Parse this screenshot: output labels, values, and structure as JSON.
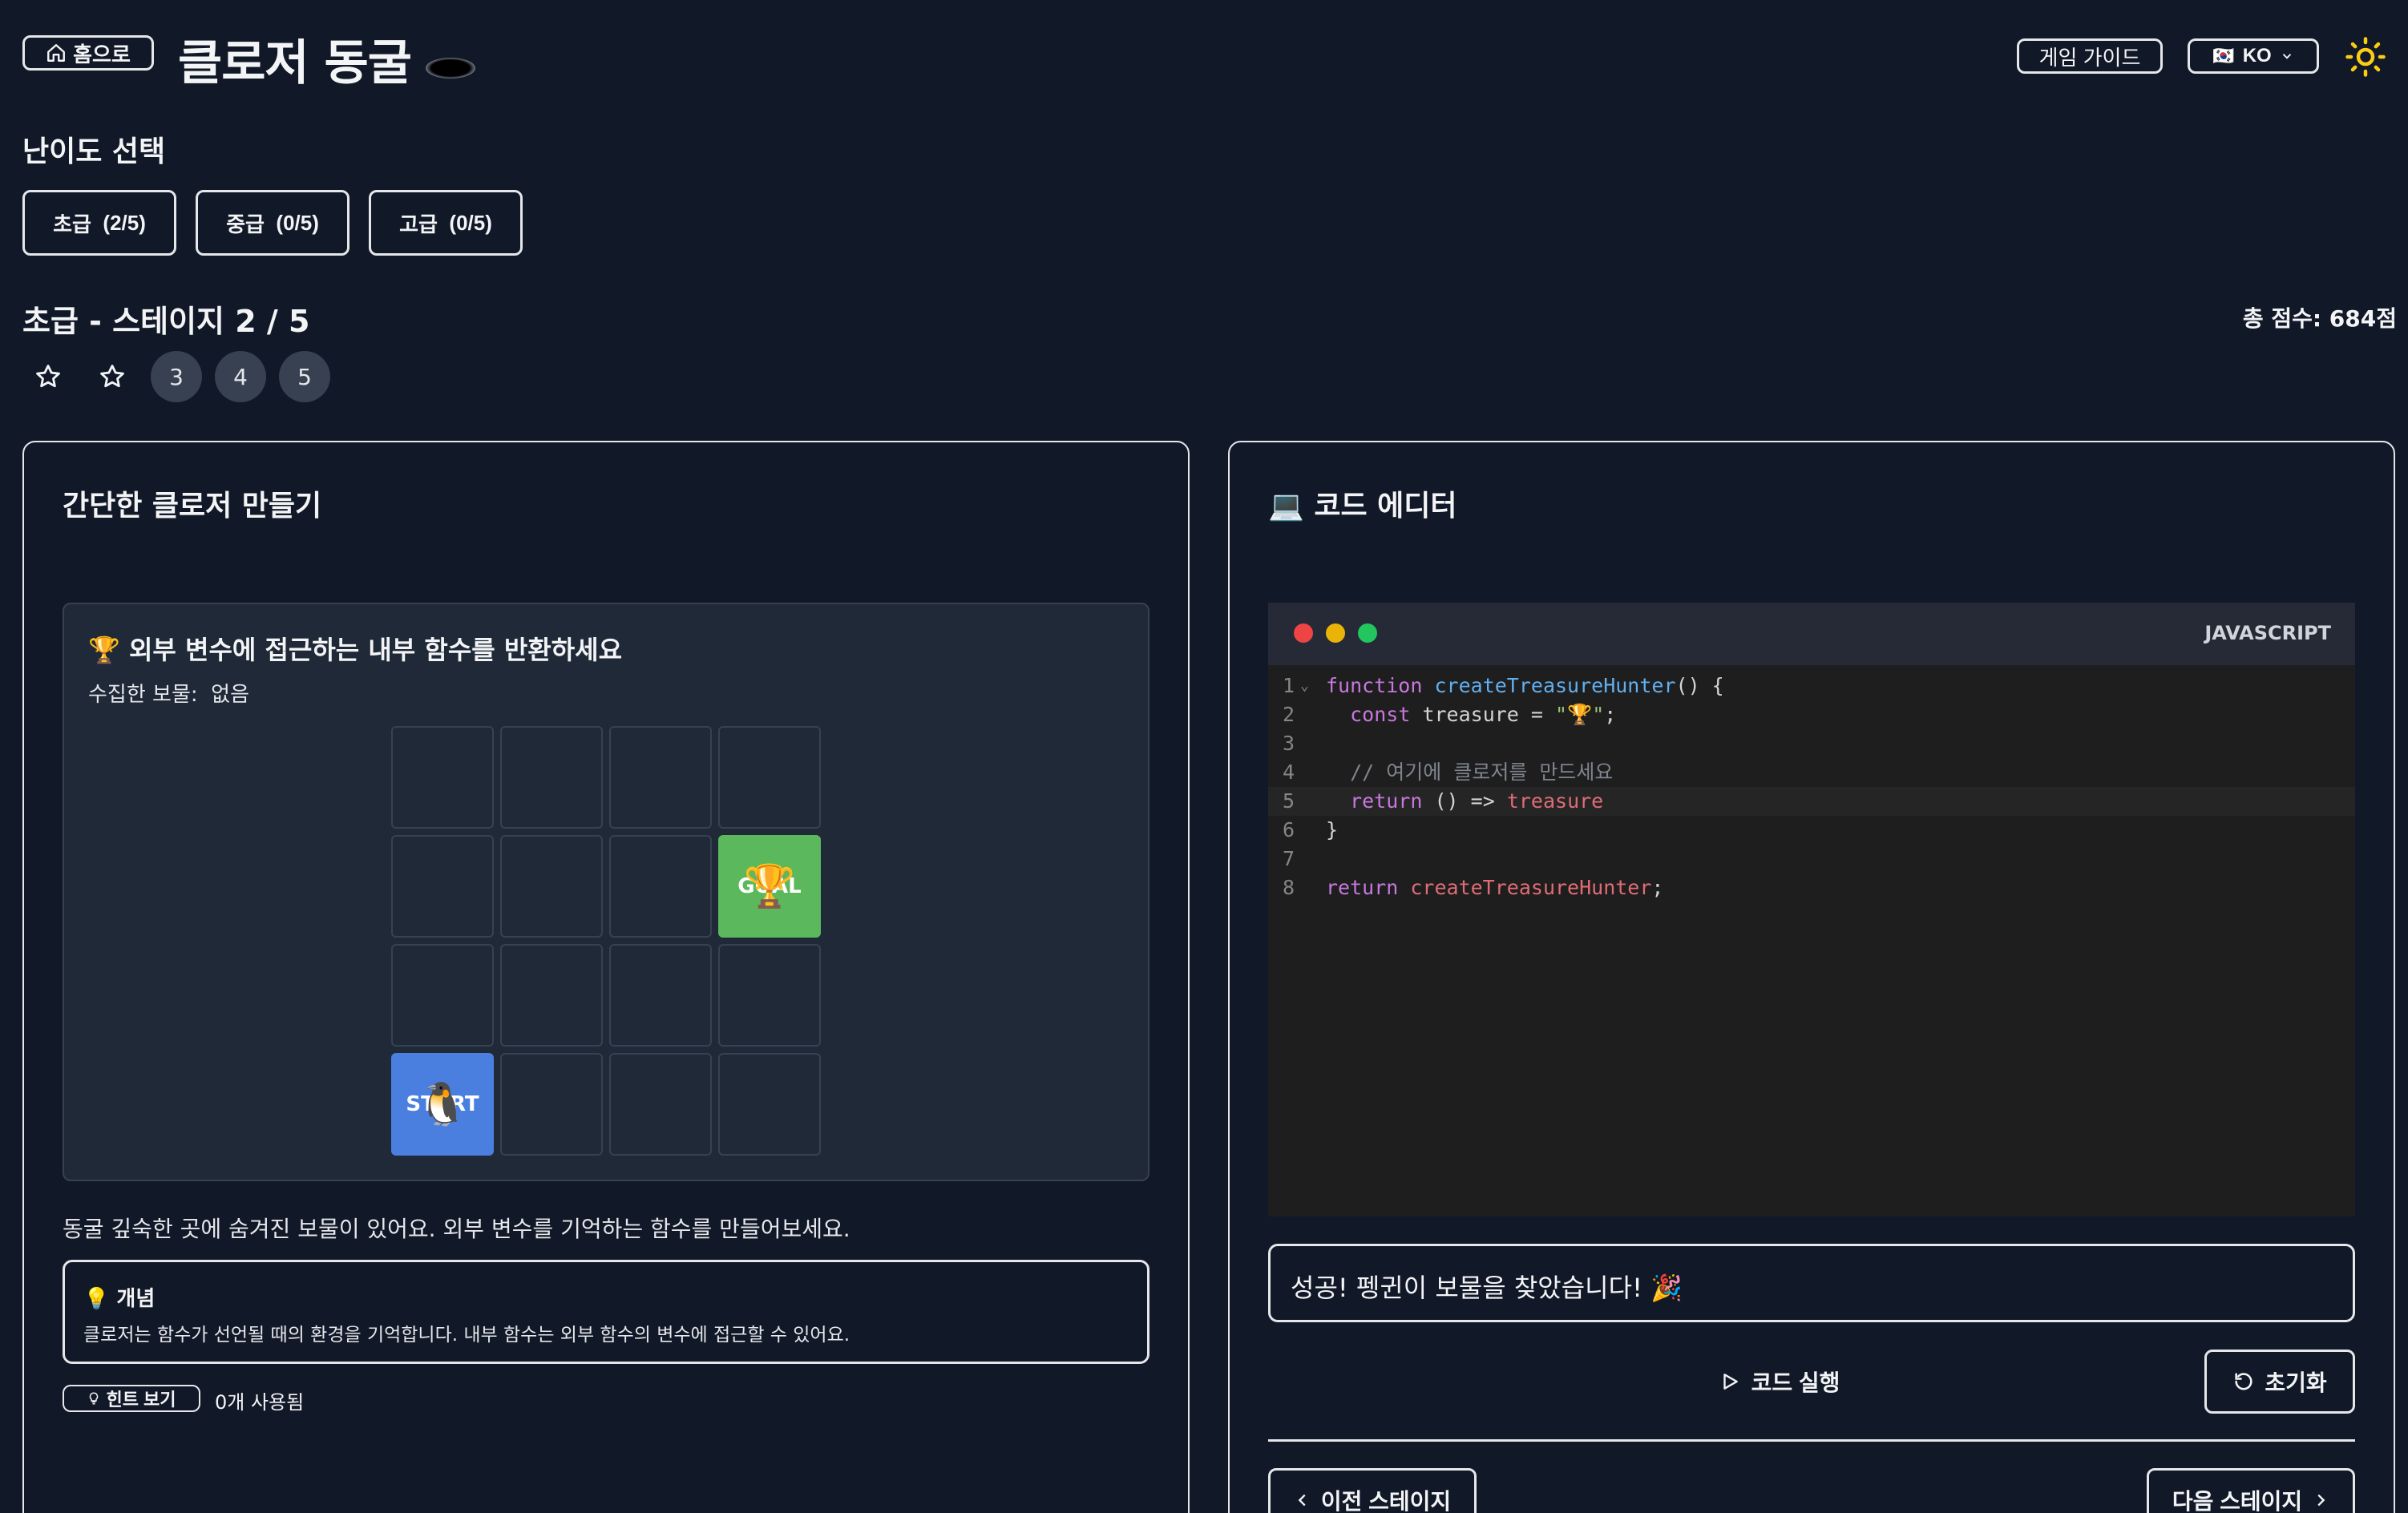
{
  "header": {
    "home_label": "홈으로",
    "title": "클로저 동굴",
    "guide_label": "게임 가이드",
    "lang_flag": "🇰🇷",
    "lang_label": "KO"
  },
  "difficulty": {
    "title": "난이도 선택",
    "levels": [
      {
        "label": "초급",
        "progress": "(2/5)"
      },
      {
        "label": "중급",
        "progress": "(0/5)"
      },
      {
        "label": "고급",
        "progress": "(0/5)"
      }
    ]
  },
  "stage": {
    "title": "초급 - 스테이지 2 / 5",
    "total_score": "총 점수: 684점",
    "stage_numbers": [
      "3",
      "4",
      "5"
    ]
  },
  "challenge": {
    "title": "간단한 클로저 만들기",
    "mission": "🏆 외부 변수에 접근하는 내부 함수를 반환하세요",
    "collected_label": "수집한 보물:",
    "collected_value": "없음",
    "goal_label": "GOAL",
    "goal_icon": "🏆",
    "start_label": "START",
    "start_icon": "🐧",
    "description": "동굴 깊숙한 곳에 숨겨진 보물이 있어요. 외부 변수를 기억하는 함수를 만들어보세요.",
    "concept_title": "💡 개념",
    "concept_text": "클로저는 함수가 선언될 때의 환경을 기억합니다. 내부 함수는 외부 함수의 변수에 접근할 수 있어요.",
    "hint_label": "힌트 보기",
    "hint_used": "0개 사용됨"
  },
  "editor": {
    "title": "💻 코드 에디터",
    "language": "JAVASCRIPT",
    "line_numbers": [
      "1",
      "2",
      "3",
      "4",
      "5",
      "6",
      "7",
      "8"
    ],
    "code": {
      "l1_kw": "function",
      "l1_fn": "createTreasureHunter",
      "l1_rest": "() {",
      "l2_kw": "const",
      "l2_var": "treasure",
      "l2_eq": "=",
      "l2_str": "\"🏆\"",
      "l2_end": ";",
      "l4_comment": "// 여기에 클로저를 만드세요",
      "l5_kw": "return",
      "l5_arrow": "() =>",
      "l5_var": "treasure",
      "l6": "}",
      "l8_kw": "return",
      "l8_var": "createTreasureHunter",
      "l8_end": ";"
    },
    "result_message": "성공! 펭귄이 보물을 찾았습니다! 🎉",
    "run_label": "코드 실행",
    "reset_label": "초기화",
    "prev_label": "이전 스테이지",
    "next_label": "다음 스테이지"
  },
  "colors": {
    "background": "#111827",
    "goal_cell": "#5cb85c",
    "start_cell": "#4a7fe0",
    "theme_icon": "#facc15"
  }
}
